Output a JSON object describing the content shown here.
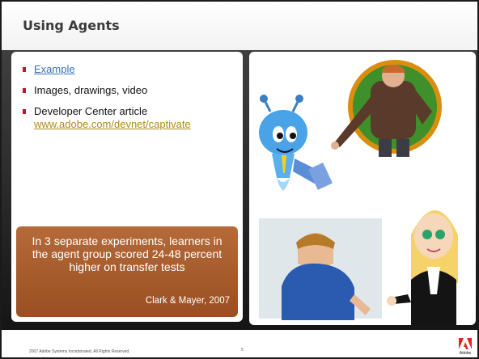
{
  "slide": {
    "title": "Using Agents",
    "bullets": [
      {
        "text": "Example",
        "is_link": true
      },
      {
        "text": "Images, drawings, video",
        "is_link": false
      },
      {
        "text": "Developer Center article",
        "link": "www.adobe.com/devnet/captivate"
      }
    ],
    "callout": {
      "text": "In 3 separate experiments, learners in the agent group scored 24-48 percent higher on transfer tests",
      "citation": "Clark & Mayer, 2007"
    },
    "images": [
      "robot-agent-illustration",
      "presenter-man-photo",
      "3d-man-character",
      "cartoon-woman-character"
    ],
    "footer": {
      "copyright": "2007 Adobe Systems Incorporated.  All Rights Reserved.",
      "page_number": "5",
      "logo_text": "Adobe"
    },
    "colors": {
      "bullet": "#c8102e",
      "link": "#3b6fb5",
      "link_alt": "#b08a1c",
      "callout": "#a85a2a",
      "background": "#2b2b2b"
    }
  }
}
